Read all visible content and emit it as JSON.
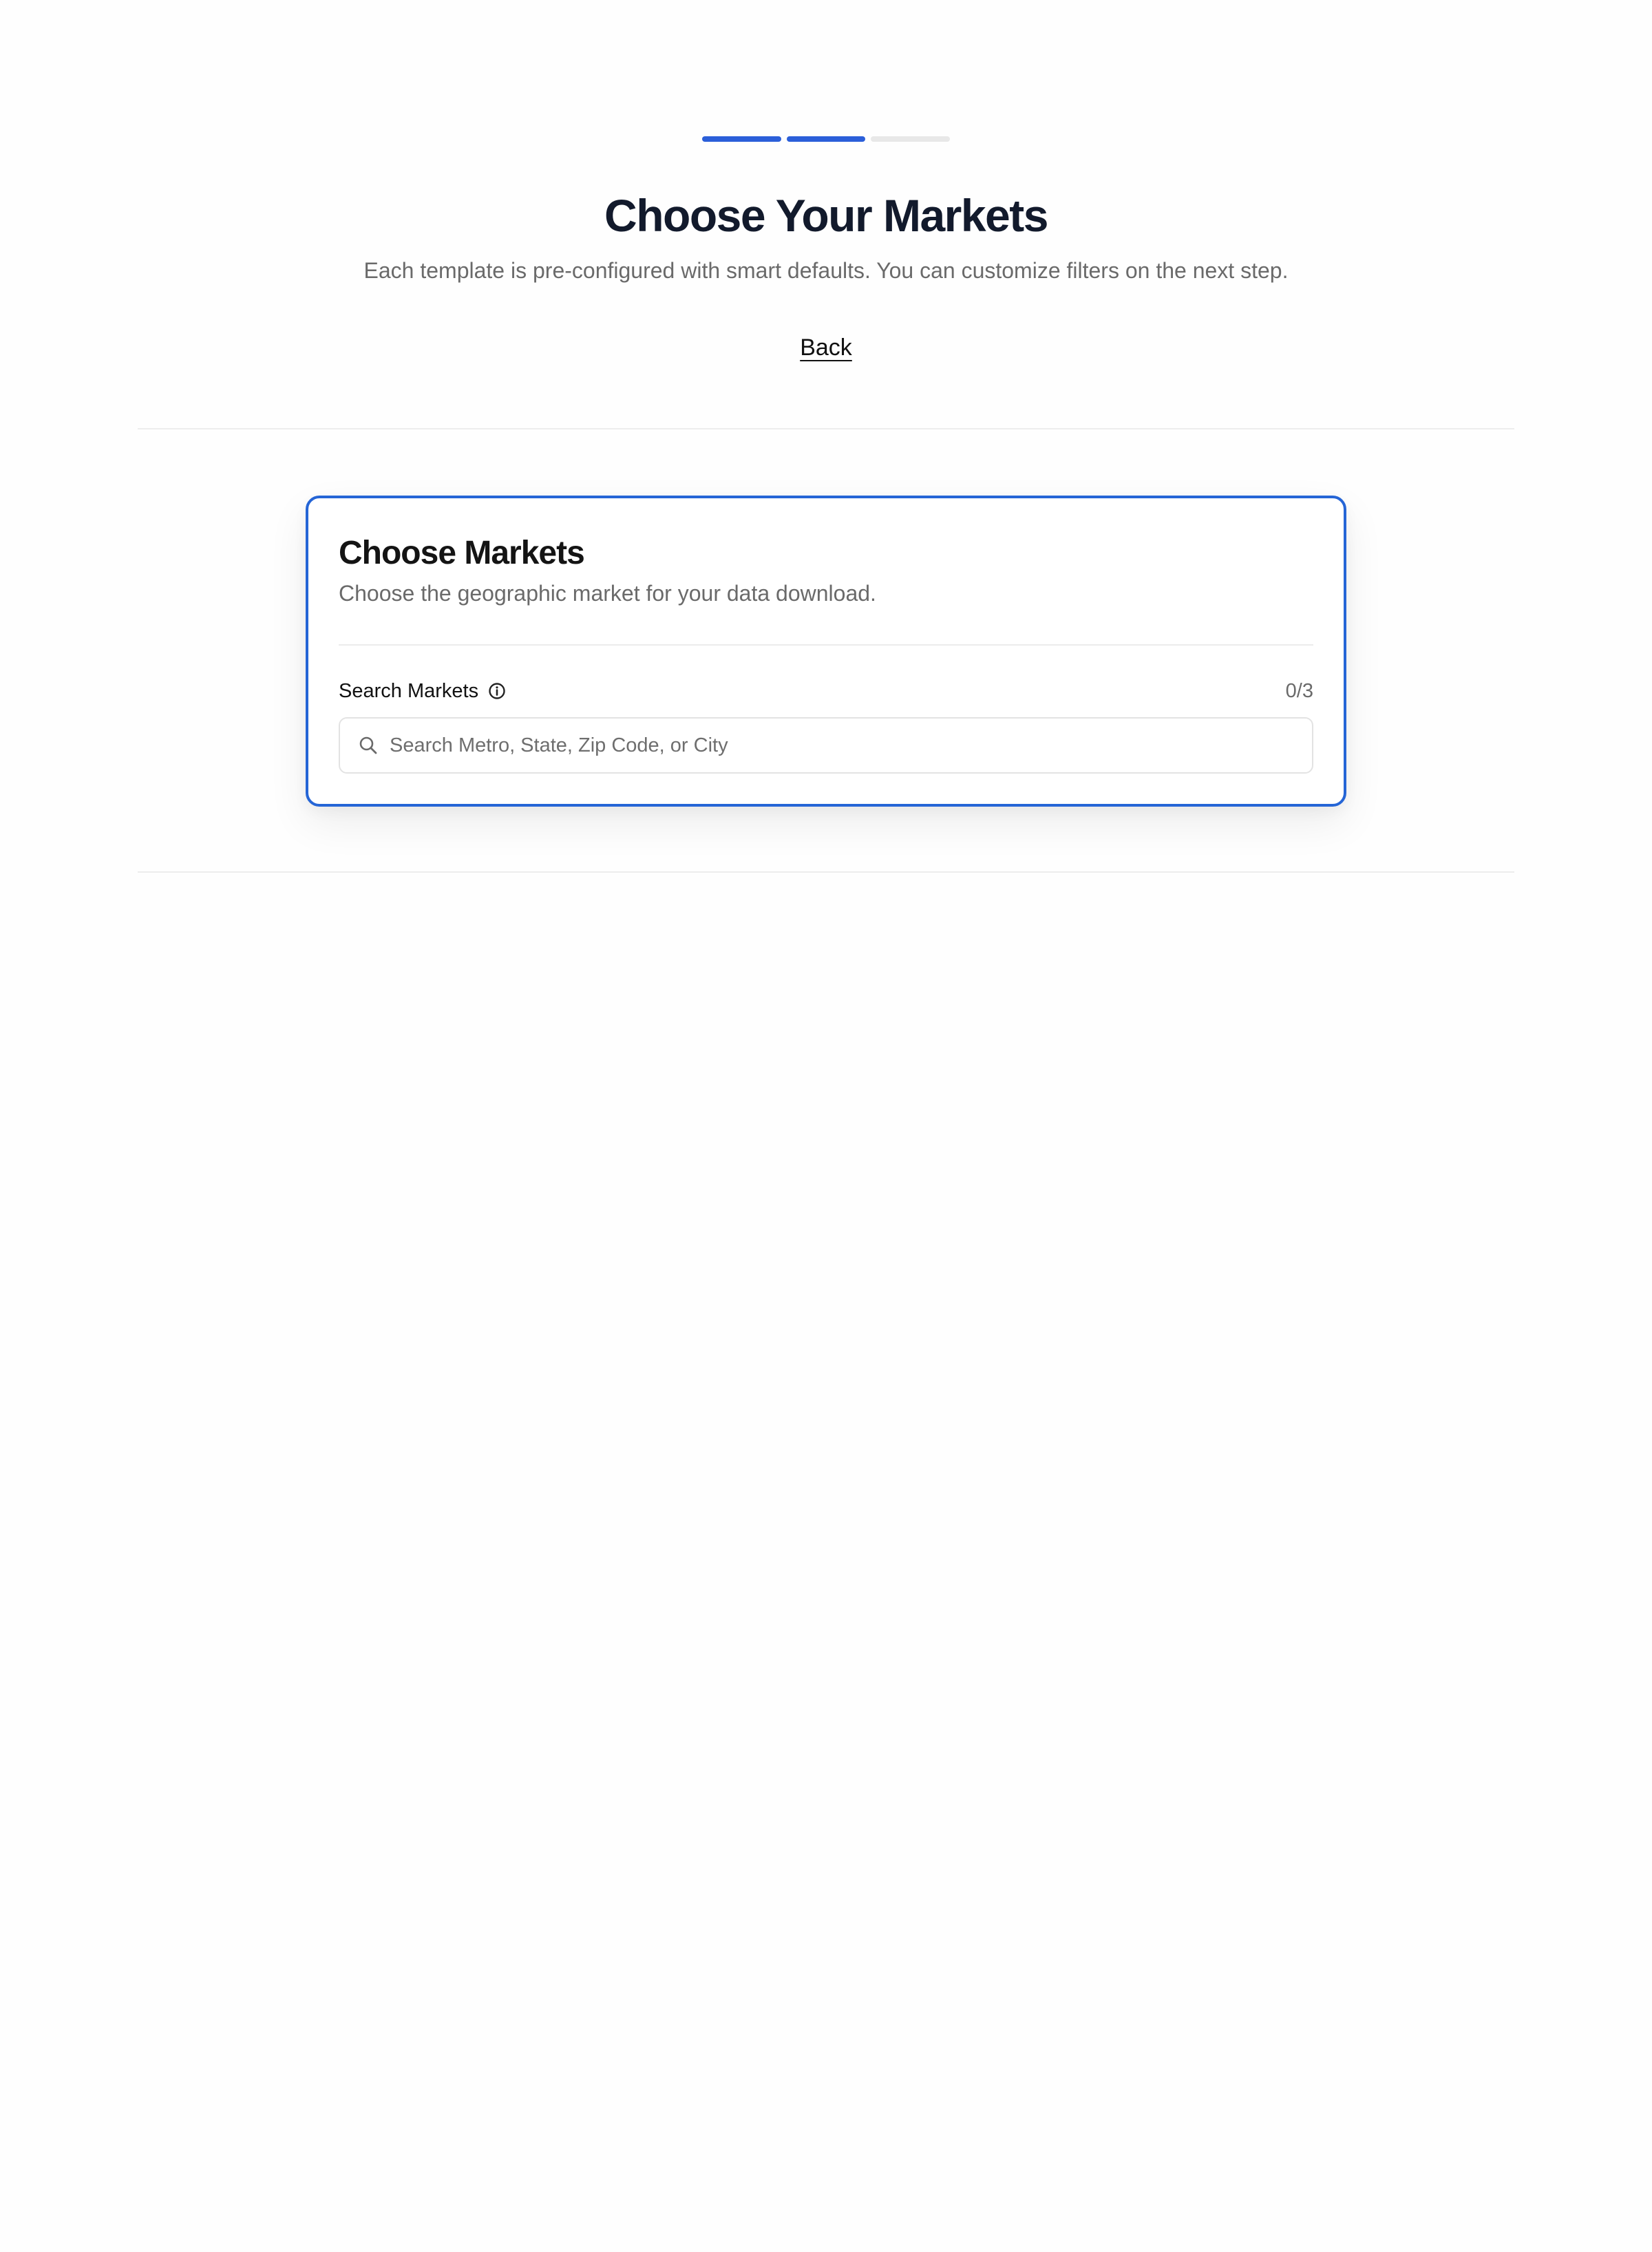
{
  "progress": {
    "total_steps": 3,
    "completed_steps": 2,
    "active_color": "#2b5fd9",
    "inactive_color": "#e8e8e8"
  },
  "header": {
    "title": "Choose Your Markets",
    "subtitle": "Each template is pre-configured with smart defaults. You can customize filters on the next step.",
    "back_label": "Back"
  },
  "card": {
    "title": "Choose Markets",
    "subtitle": "Choose the geographic market for your data download.",
    "border_color": "#2565d6",
    "search": {
      "label": "Search Markets",
      "label_icon": "info-icon",
      "counter": "0/3",
      "icon": "search-icon",
      "placeholder": "Search Metro, State, Zip Code, or City",
      "value": ""
    }
  }
}
